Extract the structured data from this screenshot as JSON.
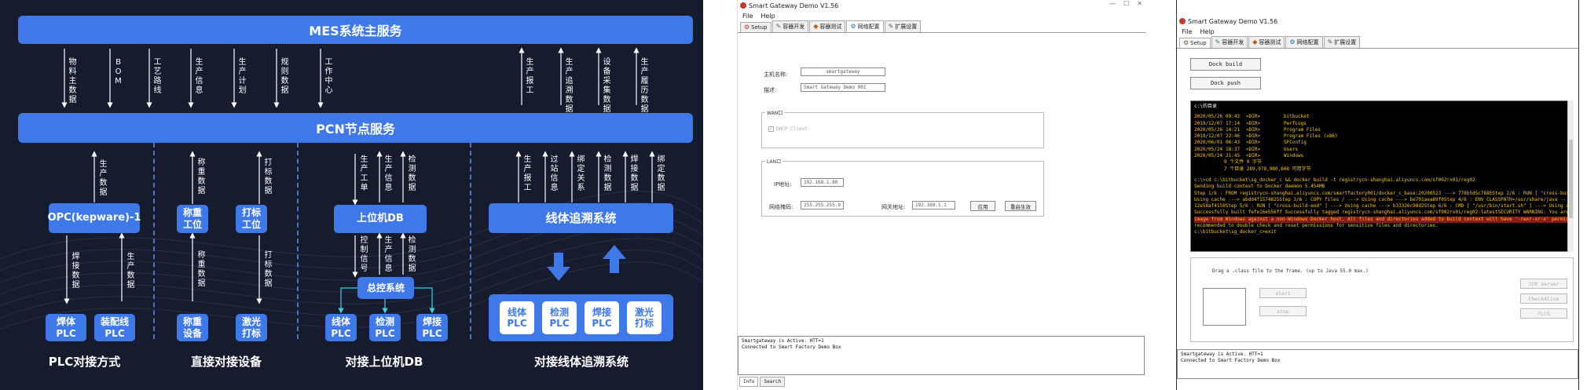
{
  "arch": {
    "mes_title": "MES系统主服务",
    "pcn_title": "PCN节点服务",
    "mes_arrows": [
      {
        "label": "物料主数据",
        "dir": "down"
      },
      {
        "label": "BOM",
        "dir": "down"
      },
      {
        "label": "工艺路线",
        "dir": "down"
      },
      {
        "label": "生产信息",
        "dir": "down"
      },
      {
        "label": "生产计划",
        "dir": "down"
      },
      {
        "label": "规则数据",
        "dir": "down"
      },
      {
        "label": "工作中心",
        "dir": "down"
      },
      {
        "label": "生产报工",
        "dir": "up"
      },
      {
        "label": "生产追溯数据",
        "dir": "up"
      },
      {
        "label": "设备采集数据",
        "dir": "up"
      },
      {
        "label": "生产履历数据",
        "dir": "up"
      }
    ],
    "sec1": {
      "top_label": "生产数据",
      "node": "OPC(kepware)-1",
      "bottom_labels": [
        "焊接数据",
        "生产数据"
      ],
      "plcs": [
        "焊体PLC",
        "装配线PLC"
      ],
      "footer": "PLC对接方式"
    },
    "sec2": {
      "top_labels": [
        "称重数据",
        "打标数据"
      ],
      "nodes": [
        "称重工位",
        "打标工位"
      ],
      "bottom_labels": [
        "称重数据",
        "打标数据"
      ],
      "devices": [
        "称重设备",
        "激光打标"
      ],
      "footer": "直接对接设备"
    },
    "sec3": {
      "top_labels": [
        "生产工单",
        "生产信息",
        "检测数据"
      ],
      "node": "上位机DB",
      "mid_labels": [
        "控制信号",
        "生产信息",
        "检测数据"
      ],
      "hub": "总控系统",
      "plcs": [
        "线体PLC",
        "检测PLC",
        "焊接PLC"
      ],
      "footer": "对接上位机DB"
    },
    "sec4": {
      "top_labels": [
        "生产报工",
        "过站信息",
        "绑定关系",
        "检测数据",
        "焊接数据",
        "绑定数据"
      ],
      "node": "线体追溯系统",
      "plcs": [
        "线体PLC",
        "检测PLC",
        "焊接PLC",
        "激光打标"
      ],
      "footer": "对接线体追溯系统"
    }
  },
  "win1": {
    "title": "Smart Gateway Demo V1.56",
    "menus": [
      "File",
      "Help"
    ],
    "tabs": [
      "Setup",
      "容器开发",
      "容器测试",
      "网络配置",
      "扩展设置"
    ],
    "host_label": "主机名称:",
    "host_value": "smartgateway",
    "desc_label": "描述:",
    "desc_value": "Smart Gateway Demo 001",
    "wan_title": "WAN口",
    "dhcp_label": "DHCP Client",
    "lan_title": "LAN口",
    "ip_label": "IP地址:",
    "ip_value": "192.168.1.80",
    "mask_label": "网络掩码:",
    "mask_value": "255.255.255.0",
    "gw_label": "网关地址:",
    "gw_value": "192.168.1.1",
    "apply_btn": "应用",
    "reset_btn": "重启生效",
    "log_lines": [
      "Smartgateway is Active. HTT=1",
      "Connected to Smart Factory Demo Box"
    ],
    "bottom_tabs": [
      "Info",
      "Search"
    ]
  },
  "win2": {
    "title": "Smart Gateway Demo V1.56",
    "menus": [
      "File",
      "Help"
    ],
    "tabs": [
      "Setup",
      "容器开发",
      "容器测试",
      "网络配置",
      "扩展设置"
    ],
    "btn_build": "Dock build",
    "btn_push": "Dock push",
    "term_header": "c:\\的目录",
    "dir_rows": [
      [
        "2020/05/26",
        "09:43",
        "<DIR>",
        "bitbucket"
      ],
      [
        "2019/12/07",
        "17:14",
        "<DIR>",
        "PerfLogs"
      ],
      [
        "2020/05/26",
        "14:21",
        "<DIR>",
        "Program Files"
      ],
      [
        "2019/12/07",
        "22:46",
        "<DIR>",
        "Program Files (x86)"
      ],
      [
        "2020/06/01",
        "06:43",
        "<DIR>",
        "SFConfig"
      ],
      [
        "2020/05/24",
        "18:37",
        "<DIR>",
        "Users"
      ],
      [
        "2020/05/24",
        "21:45",
        "<DIR>",
        "Windows"
      ]
    ],
    "dir_sum1": "0 个文件                0 字节",
    "dir_sum2": "7 个目录 289,078,980,608 可用字节",
    "build_lines": [
      "c:\\>cd c:\\bitbucket\\sg_docker_c && docker build -t registrycn-shanghai.aliyuncs.com/sf002rx01/reg02",
      "Sending build context to Docker daemon  5.454MB",
      "Step 1/6 : FROM registrycn-shanghai.aliyuncs.com/smartfactory001/docker_c_base:20200523 ---> 776b5d5c7885Step 2/6 : RUN [ \"cross-build-start\" ] --->",
      "Using cache ---> abdd4f1574825Step 3/6 : COPY files / ---> Using cache ---> be701aea89f0Step 4/6 : ENV CLASSPATH=/usr/share/java ---> Using cache --->",
      "12e58af4150Step 5/6 : RUN [ \"cross-build-end\" ] ---> Using cache ---> b33326c98d2Step 6/6 : CMD [ \"/usr/bin/start.sh\" ] ---> Using cache ---> fefe16e556ff",
      "Successfully built fefe16e556ff Successfully tagged registrycn-shanghai.aliyuncs.com/sf002rx01/reg02:latestSECURITY WARNING: You are building a Docker"
    ],
    "warn_lines": [
      "image from Windows against a non-Windows Docker host. All files and directories added to build context will have '-rwxr-xr-x' permissions. It is",
      "recommended to double check and reset permissions for sensitive files and directories."
    ],
    "prompt_line": "c:\\bitbucket\\sg_docker_c>exit",
    "drag_label": "Drag a .class file to the frame. (up to Java 55.0 max.)",
    "start_btn": "start",
    "stop_btn": "stop",
    "side_btns": [
      "JCR server",
      "CheckAlive",
      "FLCS"
    ],
    "log_lines": [
      "Smartgateway is Active. HTT=1",
      "Connected to Smart Factory Demo Box"
    ]
  }
}
